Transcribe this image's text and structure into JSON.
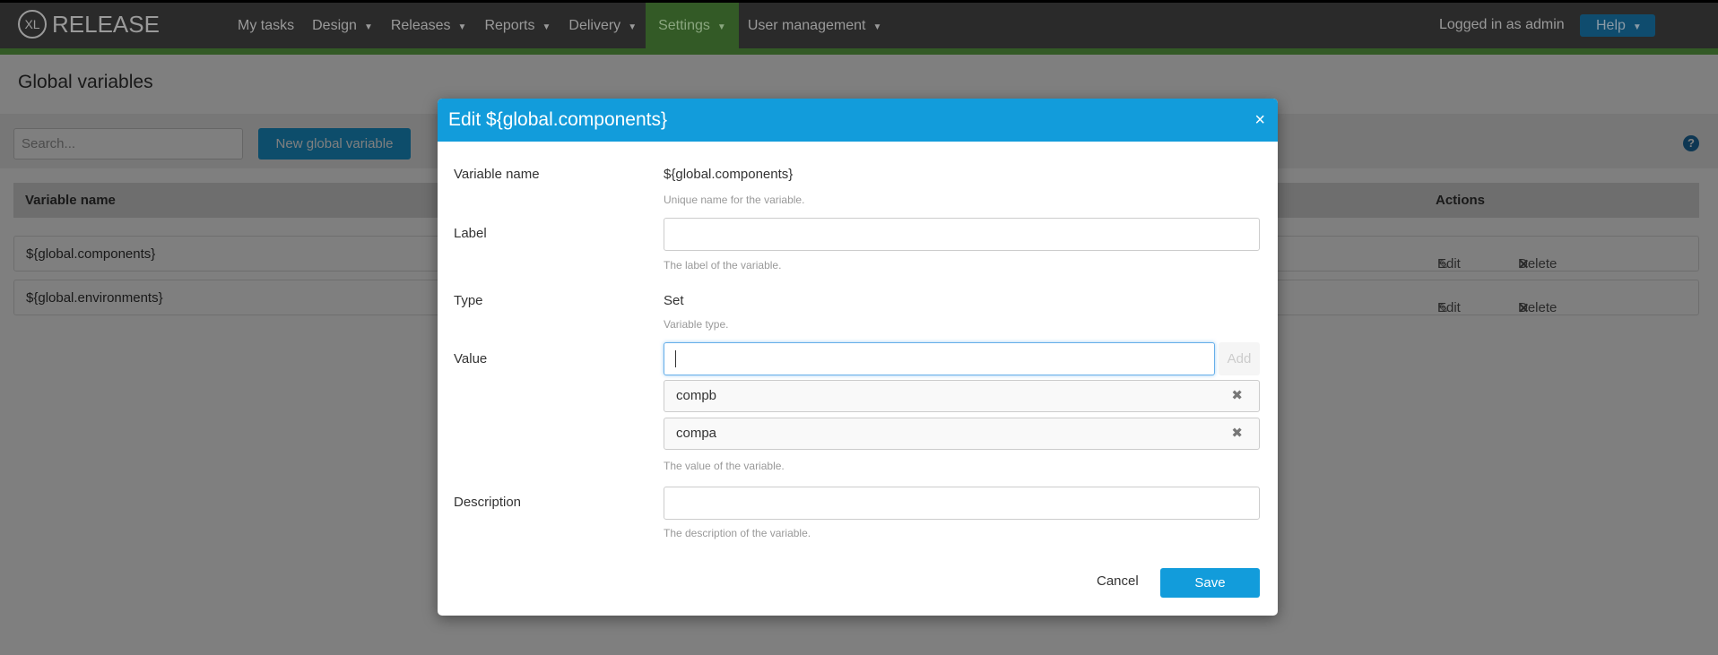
{
  "nav": {
    "logo_mark": "XL",
    "logo_text": "RELEASE",
    "items": [
      {
        "label": "My tasks",
        "caret": false
      },
      {
        "label": "Design",
        "caret": true
      },
      {
        "label": "Releases",
        "caret": true
      },
      {
        "label": "Reports",
        "caret": true
      },
      {
        "label": "Delivery",
        "caret": true
      },
      {
        "label": "Settings",
        "caret": true,
        "active": true
      },
      {
        "label": "User management",
        "caret": true
      }
    ],
    "logged_in": "Logged in as admin",
    "help": "Help"
  },
  "page": {
    "title": "Global variables",
    "search_placeholder": "Search...",
    "new_button": "New global variable",
    "help_icon": "?"
  },
  "table": {
    "headers": {
      "name": "Variable name",
      "actions": "Actions"
    },
    "rows": [
      {
        "name": "${global.components}",
        "edit": "Edit",
        "delete": "Delete"
      },
      {
        "name": "${global.environments}",
        "edit": "Edit",
        "delete": "Delete"
      }
    ]
  },
  "modal": {
    "title": "Edit ${global.components}",
    "close": "×",
    "variable_name": {
      "label": "Variable name",
      "value": "${global.components}",
      "hint": "Unique name for the variable."
    },
    "label_field": {
      "label": "Label",
      "value": "",
      "hint": "The label of the variable."
    },
    "type": {
      "label": "Type",
      "value": "Set",
      "hint": "Variable type."
    },
    "value": {
      "label": "Value",
      "input": "",
      "add": "Add",
      "items": [
        "compb",
        "compa"
      ],
      "hint": "The value of the variable."
    },
    "description": {
      "label": "Description",
      "value": "",
      "hint": "The description of the variable."
    },
    "cancel": "Cancel",
    "save": "Save"
  },
  "colors": {
    "accent": "#129cdb",
    "nav_active": "#335a26"
  }
}
